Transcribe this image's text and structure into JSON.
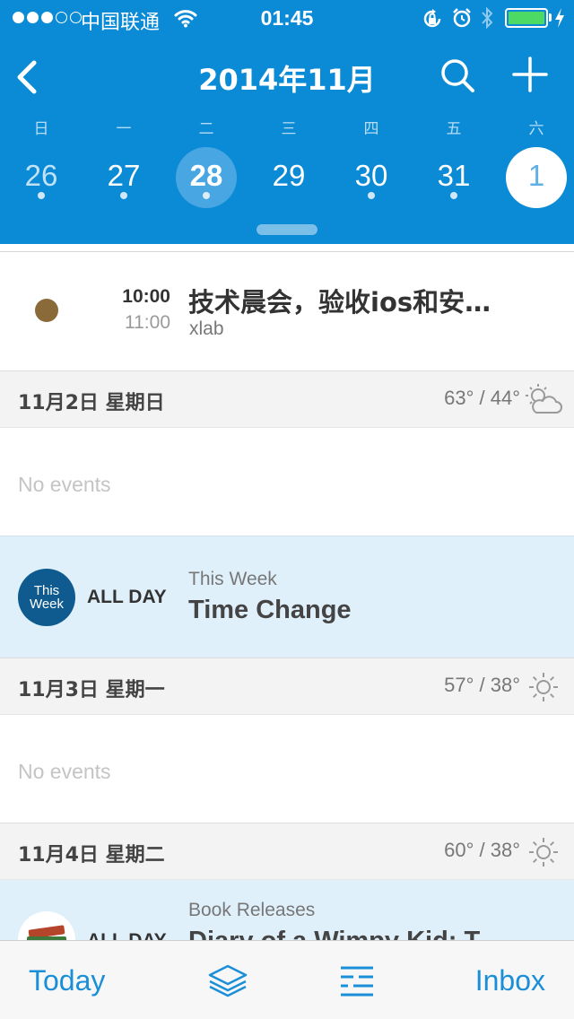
{
  "status_bar": {
    "carrier": "中国联通",
    "time": "01:45",
    "battery_level": 1.0,
    "icons": [
      "signal-dots-icon",
      "wifi-icon",
      "rotation-lock-icon",
      "alarm-icon",
      "bluetooth-icon",
      "battery-icon",
      "charging-icon"
    ]
  },
  "nav": {
    "title": "2014年11月",
    "back_icon": "chevron-left-icon",
    "search_icon": "search-icon",
    "add_icon": "plus-icon"
  },
  "week": {
    "days": [
      {
        "label": "日",
        "num": "26",
        "has_events": true,
        "state": "past"
      },
      {
        "label": "一",
        "num": "27",
        "has_events": true,
        "state": "normal"
      },
      {
        "label": "二",
        "num": "28",
        "has_events": true,
        "state": "selected"
      },
      {
        "label": "三",
        "num": "29",
        "has_events": false,
        "state": "normal"
      },
      {
        "label": "四",
        "num": "30",
        "has_events": true,
        "state": "normal"
      },
      {
        "label": "五",
        "num": "31",
        "has_events": true,
        "state": "normal"
      },
      {
        "label": "六",
        "num": "1",
        "has_events": false,
        "state": "today"
      }
    ]
  },
  "event": {
    "start": "10:00",
    "end": "11:00",
    "title": "技术晨会，验收ios和安…",
    "subtitle": "xlab",
    "color": "#8b6a3a"
  },
  "sections": [
    {
      "date": "11月2日 星期日",
      "temp": "63° / 44°",
      "weather": "partly-cloudy-icon"
    },
    {
      "date": "11月3日 星期一",
      "temp": "57° / 38°",
      "weather": "sunny-icon"
    },
    {
      "date": "11月4日 星期二",
      "temp": "60° / 38°",
      "weather": "sunny-icon"
    }
  ],
  "no_events_text": "No events",
  "allday": {
    "badge_line1": "This",
    "badge_line2": "Week",
    "label": "ALL DAY",
    "calendar": "This Week",
    "title": "Time Change"
  },
  "book": {
    "label": "ALL DAY",
    "calendar": "Book Releases",
    "title": "Diary of a Wimpy Kid: T"
  },
  "tabs": {
    "today": "Today",
    "inbox": "Inbox",
    "layers_icon": "layers-icon",
    "list_icon": "list-icon"
  },
  "colors": {
    "header_bg": "#0b8ad6",
    "accent": "#1a8fd8",
    "allday_bg": "#dff0fb",
    "battery": "#4cd964"
  }
}
